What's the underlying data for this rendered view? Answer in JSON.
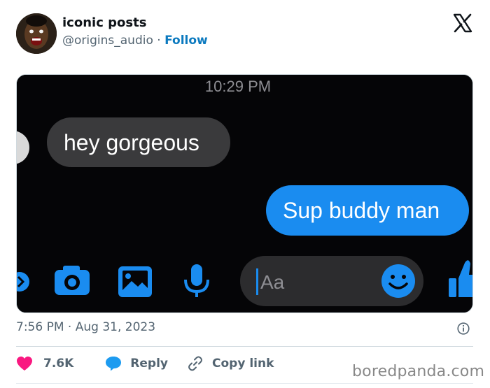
{
  "author": {
    "name": "iconic posts",
    "handle": "@origins_audio",
    "separator": "·",
    "follow_label": "Follow"
  },
  "media": {
    "timestamp": "10:29 PM",
    "received_message": "hey gorgeous",
    "sent_message": "Sup buddy man",
    "input_placeholder": "Aa",
    "icons": [
      "chevron-icon",
      "camera-icon",
      "gallery-icon",
      "microphone-icon",
      "emoji-icon",
      "thumbs-up-icon"
    ],
    "colors": {
      "sent_bubble": "#1a8cf0",
      "received_bubble": "#3a3a3c",
      "icon_blue": "#1a8cf0"
    }
  },
  "post": {
    "time": "7:56 PM",
    "separator": "·",
    "date": "Aug 31, 2023"
  },
  "actions": {
    "like_count": "7.6K",
    "reply_label": "Reply",
    "copy_link_label": "Copy link"
  },
  "watermark": "boredpanda.com",
  "colors": {
    "like": "#f91880",
    "link": "#0c7abf",
    "muted": "#536471"
  }
}
